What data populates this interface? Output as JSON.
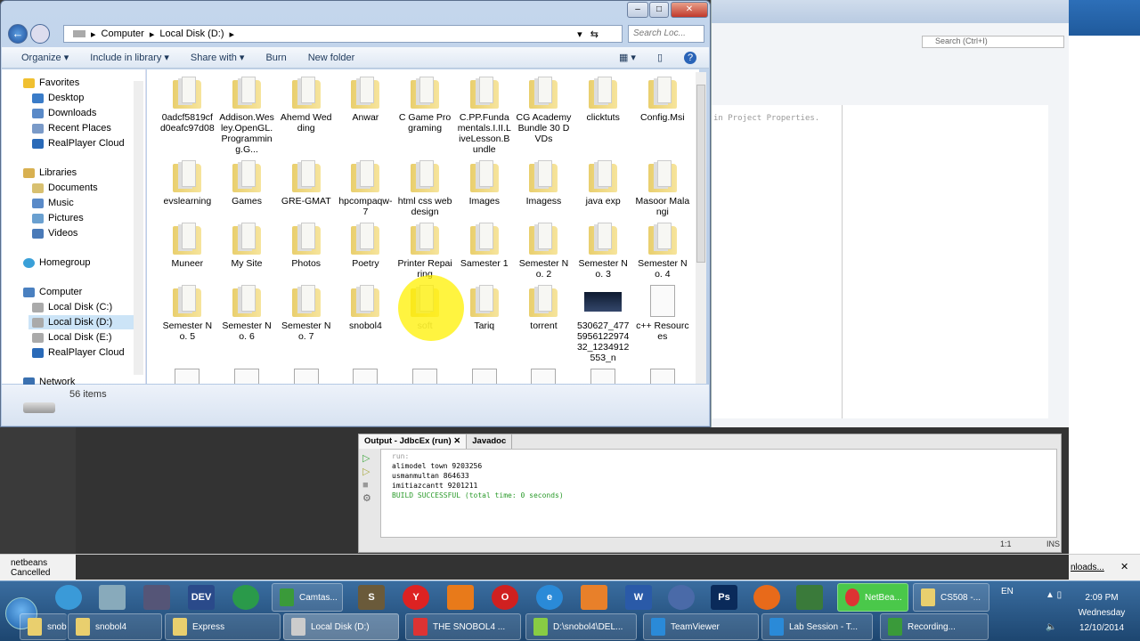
{
  "explorer": {
    "breadcrumb": [
      "Computer",
      "Local Disk (D:)"
    ],
    "search_placeholder": "Search Loc...",
    "toolbar": {
      "organize": "Organize",
      "include": "Include in library",
      "share": "Share with",
      "burn": "Burn",
      "new_folder": "New folder"
    },
    "nav": {
      "favorites": "Favorites",
      "desktop": "Desktop",
      "downloads": "Downloads",
      "recent": "Recent Places",
      "realplayer": "RealPlayer Cloud",
      "libraries": "Libraries",
      "documents": "Documents",
      "music": "Music",
      "pictures": "Pictures",
      "videos": "Videos",
      "homegroup": "Homegroup",
      "computer": "Computer",
      "c": "Local Disk (C:)",
      "d": "Local Disk (D:)",
      "e": "Local Disk (E:)",
      "realplayer2": "RealPlayer Cloud",
      "network": "Network"
    },
    "items": [
      {
        "name": "0adcf5819cfd0eafc97d08",
        "kind": "folder"
      },
      {
        "name": "Addison.Wesley.OpenGL.Programming.G...",
        "kind": "folder"
      },
      {
        "name": "Ahemd Wedding",
        "kind": "folder"
      },
      {
        "name": "Anwar",
        "kind": "folder"
      },
      {
        "name": "C  Game Programing",
        "kind": "folder"
      },
      {
        "name": "C.PP.Fundamentals.I.II.LiveLesson.Bundle",
        "kind": "folder"
      },
      {
        "name": "CG Academy Bundle 30 DVDs",
        "kind": "folder"
      },
      {
        "name": "clicktuts",
        "kind": "folder"
      },
      {
        "name": "Config.Msi",
        "kind": "folder"
      },
      {
        "name": "evslearning",
        "kind": "folder"
      },
      {
        "name": "Games",
        "kind": "folder"
      },
      {
        "name": "GRE-GMAT",
        "kind": "folder"
      },
      {
        "name": "hpcompaqw-7",
        "kind": "folder"
      },
      {
        "name": "html css web design",
        "kind": "folder"
      },
      {
        "name": "Images",
        "kind": "folder"
      },
      {
        "name": "Imagess",
        "kind": "folder"
      },
      {
        "name": "java exp",
        "kind": "folder"
      },
      {
        "name": "Masoor Malangi",
        "kind": "folder"
      },
      {
        "name": "Muneer",
        "kind": "folder"
      },
      {
        "name": "My Site",
        "kind": "folder"
      },
      {
        "name": "Photos",
        "kind": "folder"
      },
      {
        "name": "Poetry",
        "kind": "folder"
      },
      {
        "name": "Printer Repairing",
        "kind": "folder"
      },
      {
        "name": "Samester 1",
        "kind": "folder"
      },
      {
        "name": "Semester No. 2",
        "kind": "folder"
      },
      {
        "name": "Semester No. 3",
        "kind": "folder"
      },
      {
        "name": "Semester No. 4",
        "kind": "folder"
      },
      {
        "name": "Semester No. 5",
        "kind": "folder"
      },
      {
        "name": "Semester No. 6",
        "kind": "folder"
      },
      {
        "name": "Semester No. 7",
        "kind": "folder"
      },
      {
        "name": "snobol4",
        "kind": "folder"
      },
      {
        "name": "soft",
        "kind": "folder"
      },
      {
        "name": "Tariq",
        "kind": "folder"
      },
      {
        "name": "torrent",
        "kind": "folder"
      },
      {
        "name": "530627_477595612297432_1234912553_n",
        "kind": "image"
      },
      {
        "name": "c++ Resources",
        "kind": "file"
      }
    ],
    "status": "56 items"
  },
  "ide": {
    "search": "Search (Ctrl+I)",
    "code_hint": "in Project Properties."
  },
  "output": {
    "tabs": [
      "Output - JdbcEx (run)",
      "Javadoc"
    ],
    "lines": [
      "run:",
      "alimodel town 9203256",
      "usmanmultan 864633",
      "imitiazcantt 9201211"
    ],
    "success": "BUILD SUCCESSFUL (total time: 0 seconds)",
    "position": "1:1",
    "mode": "INS"
  },
  "download": {
    "name": "netbeans",
    "status": "Cancelled",
    "all": "nloads..."
  },
  "taskbar": {
    "quick": [
      "Camtas...",
      "NetBea...",
      "CS508 -..."
    ],
    "windows": [
      "snobol4",
      "Express",
      "Local Disk (D:)",
      "THE SNOBOL4 ...",
      "D:\\snobol4\\DEL...",
      "TeamViewer",
      "Lab Session - T...",
      "Recording..."
    ],
    "lang": "EN",
    "time": "2:09 PM",
    "day": "Wednesday",
    "date": "12/10/2014"
  }
}
